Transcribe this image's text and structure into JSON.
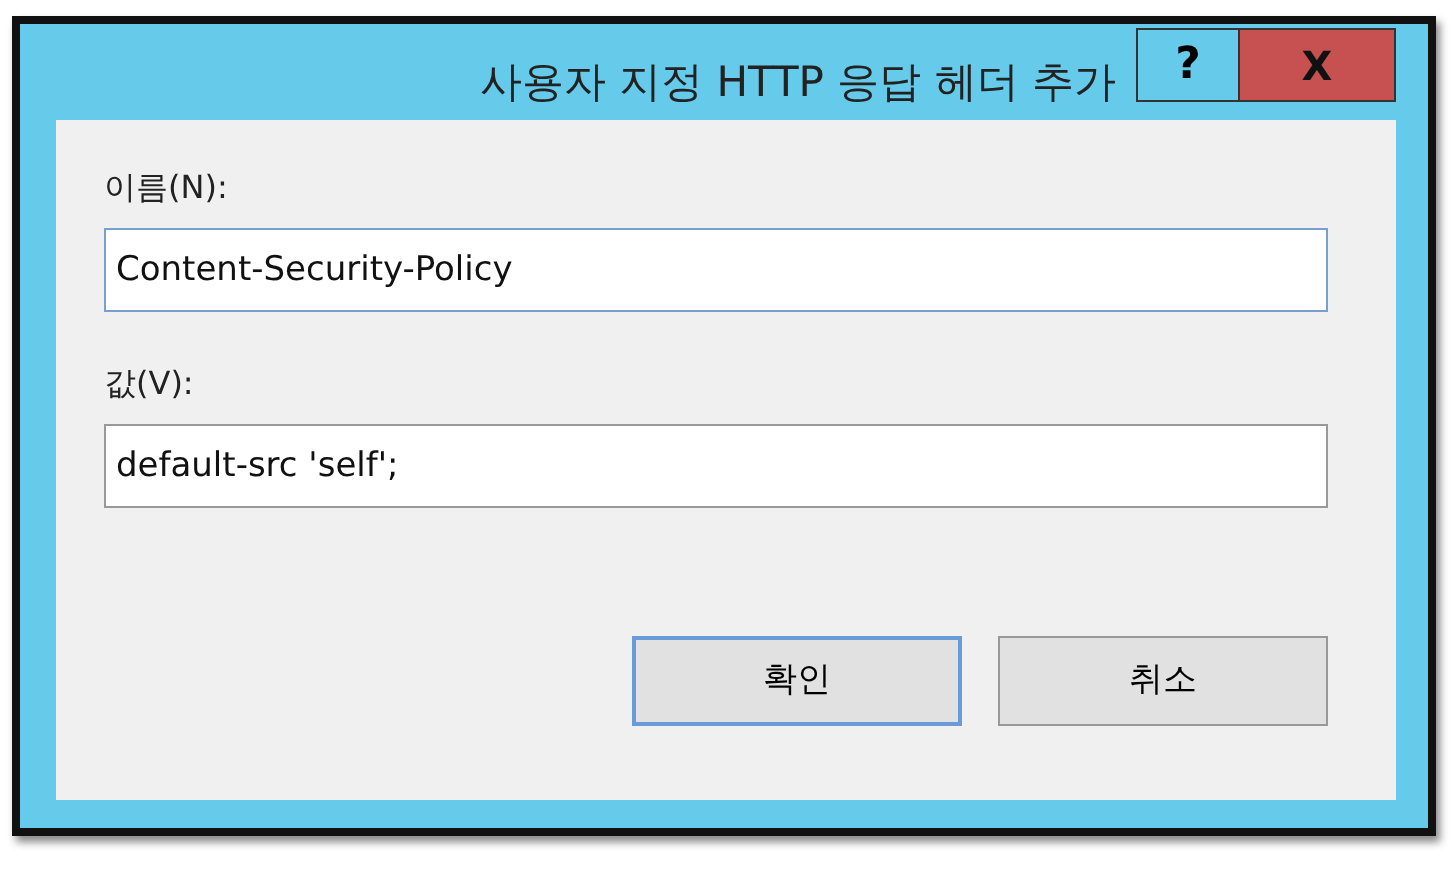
{
  "window": {
    "title": "사용자 지정 HTTP 응답 헤더 추가",
    "help_button": "?",
    "close_button": "X"
  },
  "fields": [
    {
      "label": "이름(N):",
      "value": "Content-Security-Policy",
      "focused": true
    },
    {
      "label": "값(V):",
      "value": "default-src 'self';",
      "focused": false
    }
  ],
  "buttons": [
    {
      "label": "확인",
      "default": true
    },
    {
      "label": "취소",
      "default": false
    }
  ]
}
